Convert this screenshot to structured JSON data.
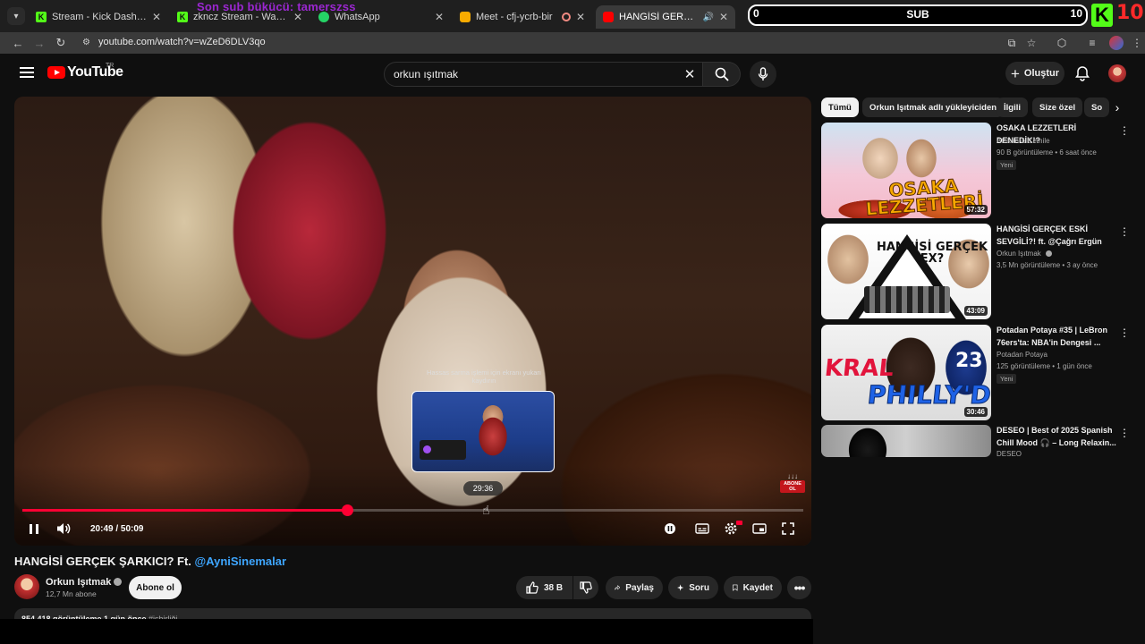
{
  "browser": {
    "tabs": [
      {
        "title": "Stream - Kick Dashboard",
        "favicon": "kick-icon"
      },
      {
        "title": "zkncz Stream - Watch Live on K",
        "favicon": "kick-icon"
      },
      {
        "title": "WhatsApp",
        "favicon": "whatsapp-icon"
      },
      {
        "title": "Meet - cfj-ycrb-bir",
        "favicon": "meet-icon"
      },
      {
        "title": "HANGİSİ GERÇEK ŞARKICI?",
        "favicon": "youtube-icon"
      }
    ],
    "url": "youtube.com/watch?v=wZeD6DLV3qo",
    "overlay_text": "Son sub bükücü: tamerszss"
  },
  "stream_widget": {
    "left_count": "0",
    "label": "SUB",
    "right_count": "10",
    "kick_logo_letter": "K",
    "kick_count": "10"
  },
  "youtube_header": {
    "logo_text": "YouTube",
    "region": "TR",
    "search_value": "orkun ışıtmak",
    "create_label": "Oluştur"
  },
  "player": {
    "current_time": "20:49",
    "separator": "/",
    "duration": "50:09",
    "time_display": "20:49 / 50:09",
    "progress_fraction": 0.416,
    "scrub_hint": "Hassas sarma işlemi için ekranı yukarı kaydırın",
    "preview_time": "29:36",
    "abone_arrows": "↓↓↓",
    "abone_label": "ABONE OL"
  },
  "video": {
    "title": "HANGİSİ GERÇEK ŞARKICI? Ft. ",
    "title_mention": "@AyniSinemalar",
    "channel_name": "Orkun Işıtmak",
    "channel_subs": "12,7 Mn abone",
    "subscribe_label": "Abone ol",
    "likes": "38 B",
    "share_label": "Paylaş",
    "ask_label": "Soru",
    "save_label": "Kaydet",
    "description_stats": "854.418 görüntüleme  1 gün önce  ",
    "description_tag": "#işbirliği"
  },
  "sidebar": {
    "chips": [
      "Tümü",
      "Orkun Işıtmak adlı yükleyiciden",
      "İlgili",
      "Size özel",
      "So"
    ],
    "recommendations": [
      {
        "title": "OSAKA LEZZETLERİ DENEDİK!?",
        "channel": "Atakan & Cemile",
        "meta": "90 B görüntüleme • 6 saat önce",
        "badge": "Yeni",
        "duration": "57:32",
        "thumb_text": "OSAKA LEZZETLERİ"
      },
      {
        "title": "HANGİSİ GERÇEK ESKİ SEVGİLİ?! ft. @Çağrı Ergün",
        "channel": "Orkun Işıtmak",
        "meta": "3,5 Mn görüntüleme • 3 ay önce",
        "badge": "",
        "duration": "43:09",
        "thumb_text": "HANGİSİ GERÇEK EX?"
      },
      {
        "title": "Potadan Potaya #35 | LeBron 76ers'ta: NBA'in Dengesi ...",
        "channel": "Potadan Potaya",
        "meta": "125 görüntüleme • 1 gün önce",
        "badge": "Yeni",
        "duration": "30:46",
        "thumb_text_1": "KRAL",
        "thumb_text_2": "PHILLY'DE",
        "thumb_number": "23"
      },
      {
        "title": "DESEO | Best of 2025 Spanish Chill Mood 🎧 – Long Relaxin...",
        "channel": "DESEO",
        "meta": "",
        "badge": "",
        "duration": ""
      }
    ]
  },
  "colors": {
    "youtube_red": "#ff0000",
    "progress_red": "#ff0033",
    "kick_green": "#53fc18",
    "mention_blue": "#3ea6ff",
    "overlay_purple": "#9b27d1"
  }
}
